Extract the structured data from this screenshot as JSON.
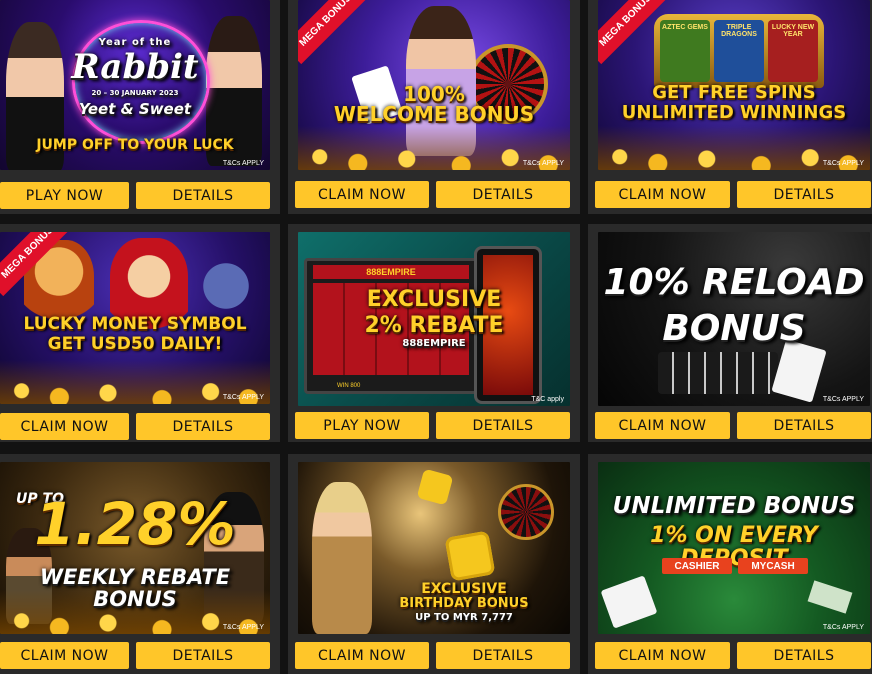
{
  "promos": [
    {
      "headline": [
        "Year of the",
        "Rabbit",
        "20 – 30 JANUARY 2023",
        "Yeet & Sweet",
        "JUMP OFF TO YOUR LUCK"
      ],
      "ribbon": "",
      "tc": "T&Cs APPLY",
      "left_button": "PLAY NOW",
      "right_button": "DETAILS"
    },
    {
      "headline": [
        "100%",
        "WELCOME BONUS"
      ],
      "ribbon": "MEGA BONUS",
      "tc": "T&Cs APPLY",
      "left_button": "CLAIM NOW",
      "right_button": "DETAILS"
    },
    {
      "headline": [
        "GET FREE SPINS",
        "UNLIMITED WINNINGS"
      ],
      "reels": [
        "AZTEC GEMS",
        "TRIPLE DRAGONS",
        "LUCKY NEW YEAR"
      ],
      "ribbon": "MEGA BONUS",
      "tc": "T&Cs APPLY",
      "left_button": "CLAIM NOW",
      "right_button": "DETAILS"
    },
    {
      "headline": [
        "LUCKY MONEY SYMBOL",
        "GET USD50 DAILY!"
      ],
      "ribbon": "MEGA BONUS",
      "tc": "T&Cs APPLY",
      "left_button": "CLAIM NOW",
      "right_button": "DETAILS"
    },
    {
      "headline": [
        "EXCLUSIVE",
        "2% REBATE",
        "888EMPIRE"
      ],
      "screen_label": "888EMPIRE",
      "win": "WIN 800",
      "ribbon": "",
      "tc": "T&C apply",
      "left_button": "PLAY NOW",
      "right_button": "DETAILS"
    },
    {
      "headline": [
        "10% RELOAD",
        "BONUS"
      ],
      "ribbon": "",
      "tc": "T&Cs APPLY",
      "left_button": "CLAIM NOW",
      "right_button": "DETAILS"
    },
    {
      "headline": [
        "UP TO",
        "1.28%",
        "WEEKLY REBATE BONUS"
      ],
      "ribbon": "",
      "tc": "T&Cs APPLY",
      "left_button": "CLAIM NOW",
      "right_button": "DETAILS"
    },
    {
      "headline": [
        "EXCLUSIVE",
        "BIRTHDAY BONUS",
        "UP TO MYR 7,777"
      ],
      "ribbon": "",
      "tc": "T&Cs APPLY",
      "left_button": "CLAIM NOW",
      "right_button": "DETAILS"
    },
    {
      "headline": [
        "UNLIMITED BONUS",
        "1% ON EVERY DEPOSIT"
      ],
      "chips": [
        "CASHIER",
        "MYCASH"
      ],
      "ribbon": "",
      "tc": "T&Cs APPLY",
      "left_button": "CLAIM NOW",
      "right_button": "DETAILS"
    }
  ],
  "colors": {
    "page_bg": "#121212",
    "card_bg": "#2a2a2a",
    "button": "#ffc629",
    "headline_gold": "#ffd12a",
    "ribbon_red": "#e0102a"
  }
}
